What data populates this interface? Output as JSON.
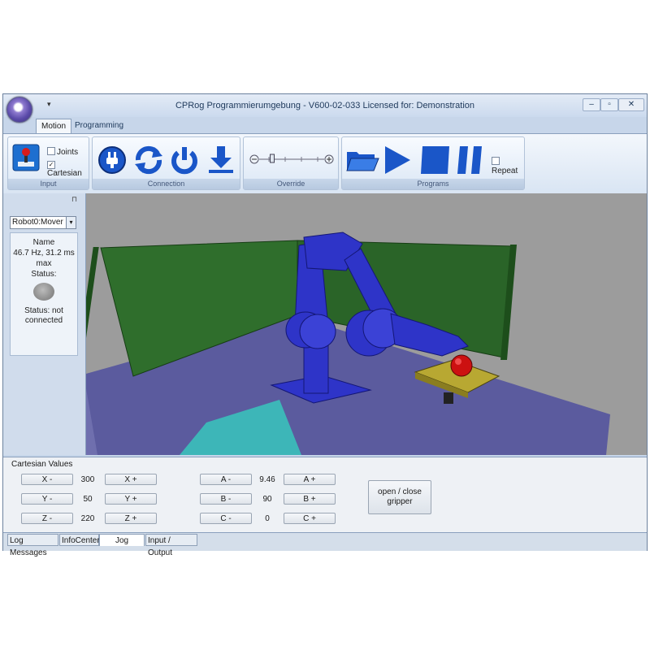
{
  "window": {
    "title": "CPRog Programmierumgebung - V600-02-033 Licensed for: Demonstration",
    "qat_glyph": "▾",
    "controls": {
      "minimize": "‒",
      "maximize": "▫",
      "close": "✕"
    }
  },
  "ribbon": {
    "tabs": [
      {
        "label": "Motion",
        "active": true
      },
      {
        "label": "Programming",
        "active": false
      }
    ],
    "groups": {
      "input": {
        "label": "Input",
        "joints_label": "Joints",
        "joints_checked": false,
        "cartesian_label": "Cartesian",
        "cartesian_checked": true
      },
      "connection": {
        "label": "Connection"
      },
      "override": {
        "label": "Override",
        "level": 0.2
      },
      "programs": {
        "label": "Programs",
        "repeat_label": "Repeat",
        "repeat_checked": false
      }
    },
    "check_mark": "✓"
  },
  "side_panel": {
    "pin_glyph": "⊓",
    "robot_select": {
      "value": "Robot0:Mover",
      "arrow": "▾"
    },
    "info": {
      "name": "Name",
      "rate": "46.7 Hz, 31.2 ms",
      "rate_suffix": "max",
      "status_label": "Status:",
      "status_line1": "Status: not",
      "status_line2": "connected"
    }
  },
  "cartesian": {
    "label": "Cartesian Values",
    "rows": [
      {
        "minus": "X -",
        "value": "300",
        "plus": "X +"
      },
      {
        "minus": "Y -",
        "value": "50",
        "plus": "Y +"
      },
      {
        "minus": "Z -",
        "value": "220",
        "plus": "Z +"
      }
    ],
    "rot_rows": [
      {
        "minus": "A -",
        "value": "9.46",
        "plus": "A +"
      },
      {
        "minus": "B -",
        "value": "90",
        "plus": "B +"
      },
      {
        "minus": "C -",
        "value": "0",
        "plus": "C +"
      }
    ],
    "gripper_line1": "open / close",
    "gripper_line2": "gripper"
  },
  "bottom_tabs": [
    {
      "label": "Log Messages"
    },
    {
      "label": "InfoCenter"
    },
    {
      "label": "Jog",
      "active": true
    },
    {
      "label": "Input / Output"
    }
  ],
  "colors": {
    "robot": "#2e34c8",
    "wall": "#2e6b2c",
    "floor": "#5b5b9e",
    "ball": "#cc1111",
    "table": "#b8a832"
  }
}
